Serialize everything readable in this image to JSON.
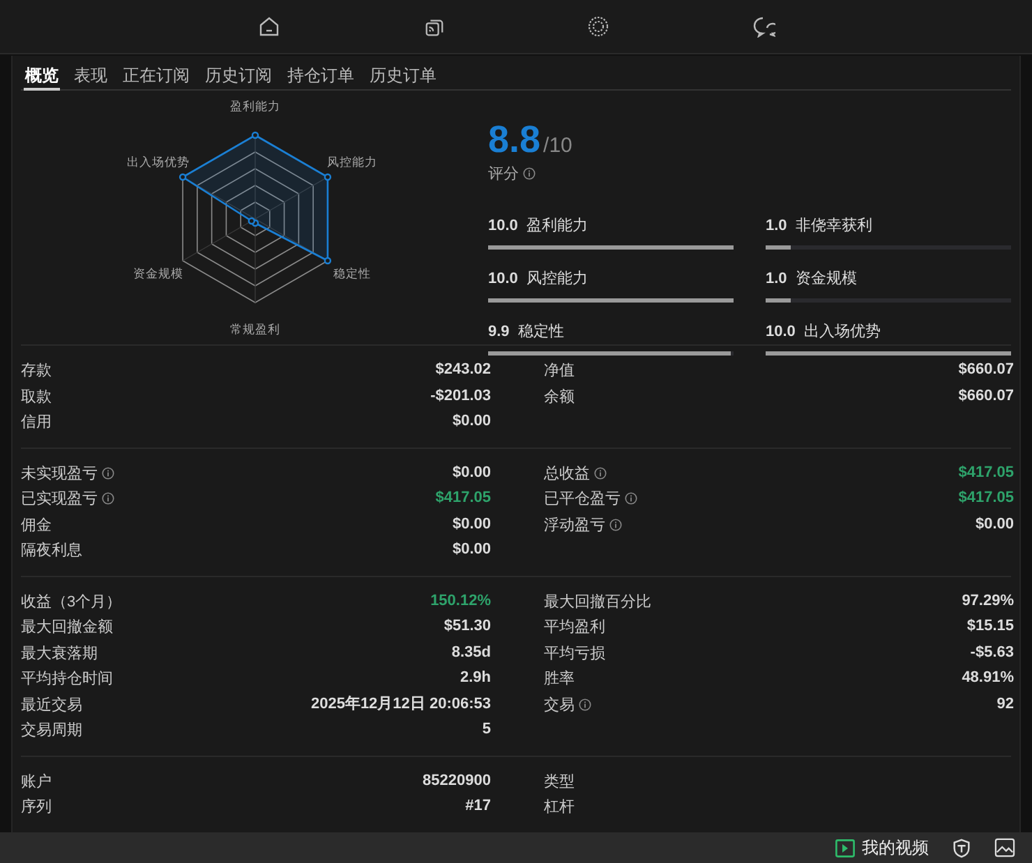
{
  "nav": {
    "items": [
      {
        "kind": "home"
      },
      {
        "kind": "feed"
      },
      {
        "kind": "badge"
      },
      {
        "kind": "chat"
      }
    ]
  },
  "tabs": [
    {
      "label": "概览",
      "selected": true
    },
    {
      "label": "表现",
      "selected": false
    },
    {
      "label": "正在订阅",
      "selected": false
    },
    {
      "label": "历史订阅",
      "selected": false
    },
    {
      "label": "持仓订单",
      "selected": false
    },
    {
      "label": "历史订单",
      "selected": false
    }
  ],
  "radar": {
    "axes": [
      {
        "label": "盈利能力"
      },
      {
        "label": "风控能力"
      },
      {
        "label": "稳定性"
      },
      {
        "label": "常规盈利"
      },
      {
        "label": "资金规模"
      },
      {
        "label": "出入场优势"
      }
    ]
  },
  "score": {
    "value": "8.8",
    "max": "/10",
    "label": "评分"
  },
  "score_bars": [
    {
      "value": "10.0",
      "label": "盈利能力",
      "level": 1
    },
    {
      "value": "1.0",
      "label": "非侥幸获利",
      "level": 0.1
    },
    {
      "value": "10.0",
      "label": "风控能力",
      "level": 1
    },
    {
      "value": "1.0",
      "label": "资金规模",
      "level": 0.1
    },
    {
      "value": "9.9",
      "label": "稳定性",
      "level": 0.99
    },
    {
      "value": "10.0",
      "label": "出入场优势",
      "level": 1
    }
  ],
  "sections": [
    {
      "left": [
        {
          "kind": "plain",
          "label": "存款",
          "value": "$243.02",
          "color": "#dddddd"
        },
        {
          "kind": "plain",
          "label": "取款",
          "value": "-$201.03",
          "color": "#dddddd"
        },
        {
          "kind": "plain",
          "label": "信用",
          "value": "$0.00",
          "color": "#dddddd"
        }
      ],
      "right": [
        {
          "kind": "plain",
          "label": "净值",
          "value": "$660.07",
          "color": "#dddddd"
        },
        {
          "kind": "plain",
          "label": "余额",
          "value": "$660.07",
          "color": "#dddddd"
        }
      ]
    },
    {
      "left": [
        {
          "kind": "info",
          "label": "未实现盈亏",
          "value": "$0.00",
          "color": "#dddddd"
        },
        {
          "kind": "info",
          "label": "已实现盈亏",
          "value": "$417.05",
          "color": "#2ea36b"
        },
        {
          "kind": "plain",
          "label": "佣金",
          "value": "$0.00",
          "color": "#dddddd"
        },
        {
          "kind": "plain",
          "label": "隔夜利息",
          "value": "$0.00",
          "color": "#dddddd"
        }
      ],
      "right": [
        {
          "kind": "info",
          "label": "总收益",
          "value": "$417.05",
          "color": "#2ea36b"
        },
        {
          "kind": "info",
          "label": "已平仓盈亏",
          "value": "$417.05",
          "color": "#2ea36b"
        },
        {
          "kind": "info",
          "label": "浮动盈亏",
          "value": "$0.00",
          "color": "#dddddd"
        }
      ]
    },
    {
      "left": [
        {
          "kind": "plain",
          "label": "收益（3个月）",
          "value": "150.12%",
          "color": "#2ea36b"
        },
        {
          "kind": "plain",
          "label": "最大回撤金额",
          "value": "$51.30",
          "color": "#dddddd"
        },
        {
          "kind": "plain",
          "label": "最大衰落期",
          "value": "8.35d",
          "color": "#dddddd"
        },
        {
          "kind": "plain",
          "label": "平均持仓时间",
          "value": "2.9h",
          "color": "#dddddd"
        },
        {
          "kind": "plain",
          "label": "最近交易",
          "value": "2025年12月12日 20:06:53",
          "color": "#dddddd"
        },
        {
          "kind": "plain",
          "label": "交易周期",
          "value": "5",
          "color": "#dddddd"
        }
      ],
      "right": [
        {
          "kind": "plain",
          "label": "最大回撤百分比",
          "value": "97.29%",
          "color": "#dddddd"
        },
        {
          "kind": "plain",
          "label": "平均盈利",
          "value": "$15.15",
          "color": "#dddddd"
        },
        {
          "kind": "plain",
          "label": "平均亏损",
          "value": "-$5.63",
          "color": "#dddddd"
        },
        {
          "kind": "plain",
          "label": "胜率",
          "value": "48.91%",
          "color": "#dddddd"
        },
        {
          "kind": "info",
          "label": "交易",
          "value": "92",
          "color": "#dddddd"
        }
      ]
    },
    {
      "left": [
        {
          "kind": "plain",
          "label": "账户",
          "value": "85220900",
          "color": "#dddddd"
        },
        {
          "kind": "plain",
          "label": "序列",
          "value": "#17",
          "color": "#dddddd"
        }
      ],
      "right": [
        {
          "kind": "plain",
          "label": "类型"
        },
        {
          "kind": "plain",
          "label": "杠杆"
        }
      ]
    }
  ],
  "bottom_bar": {
    "video_label": "我的视频"
  }
}
